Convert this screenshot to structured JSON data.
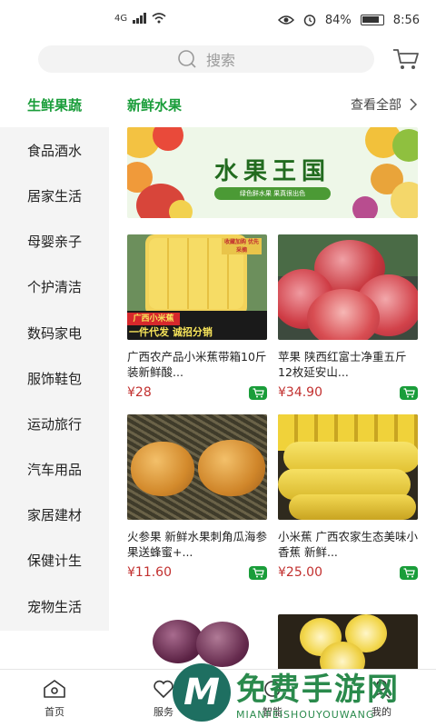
{
  "status_bar": {
    "network": "4G",
    "battery": "84%",
    "time": "8:56"
  },
  "search": {
    "placeholder": "搜索"
  },
  "sidebar": {
    "items": [
      {
        "label": "生鲜果蔬",
        "active": true
      },
      {
        "label": "食品酒水"
      },
      {
        "label": "居家生活"
      },
      {
        "label": "母婴亲子"
      },
      {
        "label": "个护清洁"
      },
      {
        "label": "数码家电"
      },
      {
        "label": "服饰鞋包"
      },
      {
        "label": "运动旅行"
      },
      {
        "label": "汽车用品"
      },
      {
        "label": "家居建材"
      },
      {
        "label": "保健计生"
      },
      {
        "label": "宠物生活"
      }
    ]
  },
  "section": {
    "title": "新鲜水果",
    "view_all": "查看全部"
  },
  "banner": {
    "title": "水果王国",
    "subtitle": "绿色鲜水果 果真很出色"
  },
  "products": [
    {
      "name": "广西农产品小米蕉带箱10斤装新鲜酸...",
      "price": "¥28",
      "img_tag": "广西小米蕉",
      "img_slogan": "一件代发 诚招分销",
      "img_badge": "收藏加购 优先采摘"
    },
    {
      "name": "苹果 陕西红富士净重五斤12枚延安山...",
      "price": "¥34.90"
    },
    {
      "name": "火参果 新鲜水果刺角瓜海参果送蜂蜜+...",
      "price": "¥11.60"
    },
    {
      "name": "小米蕉 广西农家生态美味小香蕉 新鲜...",
      "price": "¥25.00"
    }
  ],
  "tab_bar": {
    "items": [
      {
        "label": "首页"
      },
      {
        "label": "服务"
      },
      {
        "label": "智能"
      },
      {
        "label": "我的"
      }
    ]
  },
  "watermark": {
    "cn": "免费手游网",
    "en": "MIANFEISHOUYOUWANG"
  },
  "colors": {
    "accent": "#1a9d3a",
    "price": "#c2302f",
    "sidebar_bg": "#f4f4f4"
  }
}
